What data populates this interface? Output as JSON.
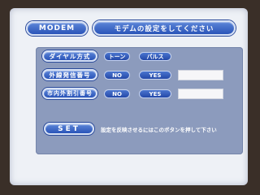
{
  "header": {
    "modem_label": "MODEM",
    "title": "モデムの設定をしてください"
  },
  "rows": [
    {
      "label": "ダイヤル方式",
      "options": [
        "トーン",
        "パルス"
      ]
    },
    {
      "label": "外線発信番号",
      "options": [
        "NO",
        "YES"
      ],
      "field_value": ""
    },
    {
      "label": "市内外割引番号",
      "options": [
        "NO",
        "YES"
      ],
      "field_value": ""
    }
  ],
  "set": {
    "label": "SET",
    "hint": "設定を反映させるにはこのボタンを押して下さい"
  }
}
